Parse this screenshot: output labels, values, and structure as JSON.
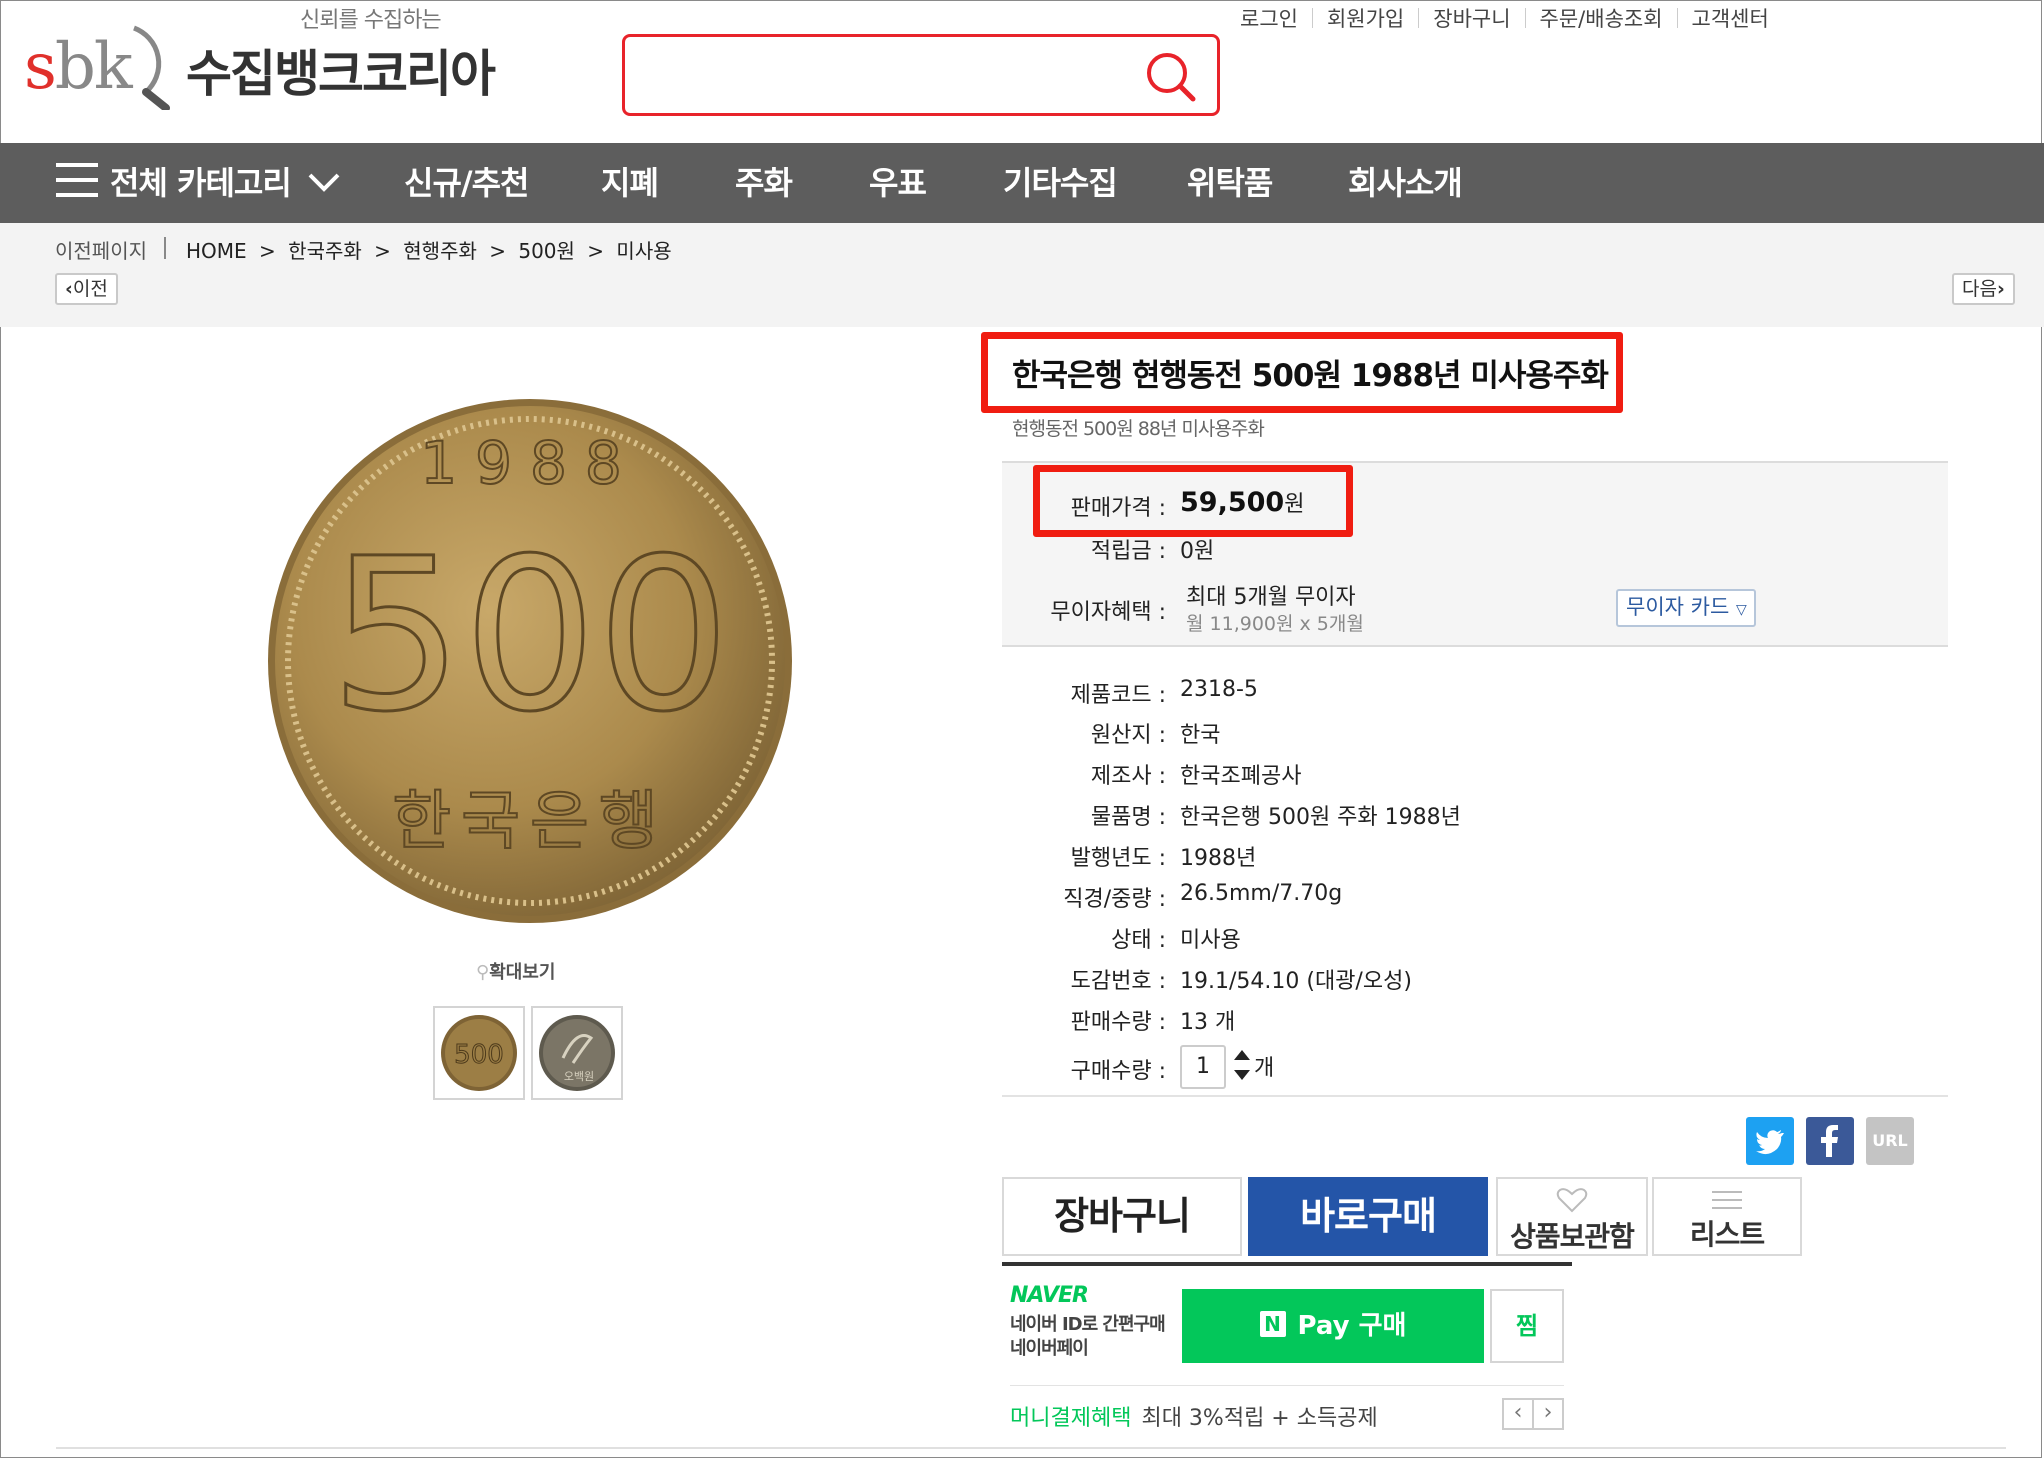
{
  "header": {
    "tagline": "신뢰를 수집하는",
    "logo_text": "sbk",
    "brand_name": "수집뱅크코리아",
    "search": {
      "value": "",
      "placeholder": ""
    },
    "top_links": [
      "로그인",
      "회원가입",
      "장바구니",
      "주문/배송조회",
      "고객센터"
    ]
  },
  "gnb": {
    "all_categories": "전체 카테고리",
    "items": [
      "신규/추천",
      "지폐",
      "주화",
      "우표",
      "기타수집",
      "위탁품",
      "회사소개"
    ]
  },
  "location": {
    "prev_page": "이전페이지",
    "breadcrumb": [
      "HOME",
      ">",
      "한국주화",
      ">",
      "현행주화",
      ">",
      "500원",
      ">",
      "미사용"
    ],
    "prev_button": "이전",
    "next_button": "다음"
  },
  "gallery": {
    "coin_year": "1988",
    "coin_denomination": "500",
    "coin_issuer": "한국은행",
    "zoom_label": "확대보기",
    "thumb_back_text": "500",
    "thumb_front_text": "오백원"
  },
  "product": {
    "title": "한국은행 현행동전 500원 1988년 미사용주화",
    "subtitle": "현행동전 500원 88년 미사용주화",
    "price_label": "판매가격 :",
    "price_value": "59,500",
    "price_unit": "원",
    "points_label": "적립금 :",
    "points_value": "0원",
    "installment_label": "무이자혜택 :",
    "installment_value": "최대 5개월 무이자",
    "installment_detail": "월 11,900원 x 5개월",
    "card_button": "무이자 카드",
    "specs": [
      {
        "label": "제품코드 :",
        "value": "2318-5"
      },
      {
        "label": "원산지 :",
        "value": "한국"
      },
      {
        "label": "제조사 :",
        "value": "한국조폐공사"
      },
      {
        "label": "물품명 :",
        "value": "한국은행 500원 주화 1988년"
      },
      {
        "label": "발행년도 :",
        "value": "1988년"
      },
      {
        "label": "직경/중량 :",
        "value": "26.5mm/7.70g"
      },
      {
        "label": "상태 :",
        "value": "미사용"
      },
      {
        "label": "도감번호 :",
        "value": "19.1/54.10 (대광/오성)"
      },
      {
        "label": "판매수량 :",
        "value": "13 개"
      }
    ],
    "qty_label": "구매수량 :",
    "qty_value": "1",
    "qty_unit": "개"
  },
  "share": {
    "url_label": "URL"
  },
  "actions": {
    "cart": "장바구니",
    "buy_now": "바로구매",
    "wishlist": "상품보관함",
    "list": "리스트"
  },
  "naver": {
    "logo": "NAVER",
    "desc_line1": "네이버 ID로 간편구매",
    "desc_line2": "네이버페이",
    "pay_badge": "N",
    "pay_button": "Pay 구매",
    "zzim": "찜",
    "money_benefit_label": "머니결제혜택",
    "money_benefit_text": "최대 3%적립 + 소득공제"
  },
  "colors": {
    "brand_red": "#e8232a",
    "gnb_bg": "#5d5d5d",
    "buy_blue": "#2455a8",
    "naver_green": "#03c75a",
    "highlight_red": "#f01d11"
  }
}
